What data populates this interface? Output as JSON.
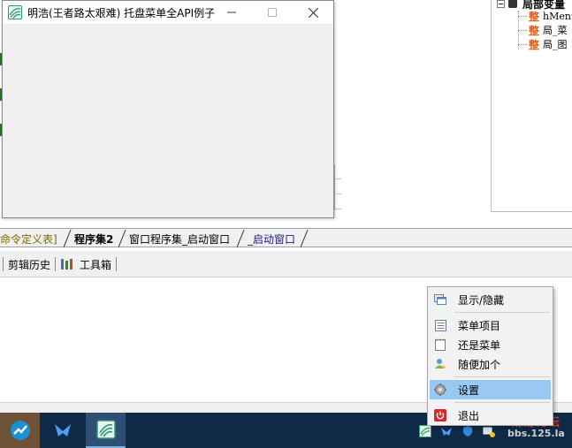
{
  "dialog": {
    "title": "明浩(王者路太艰难) 托盘菜单全API例子",
    "minimize_glyph": "—",
    "maximize_glyph": "☐",
    "close_glyph": "✕"
  },
  "tree": {
    "header": "局部变量",
    "expander": "−",
    "items": [
      {
        "badge": "整",
        "label": "hMenu"
      },
      {
        "badge": "整",
        "label": "局_菜"
      },
      {
        "badge": "整",
        "label": "局_图"
      }
    ]
  },
  "tabs": [
    {
      "label": "命令定义表]"
    },
    {
      "label": "程序集2"
    },
    {
      "label": "窗口程序集_启动窗口"
    },
    {
      "label": "_启动窗口"
    }
  ],
  "toolbar": {
    "clipboard_history": "剪辑历史",
    "toolbox": "工具箱"
  },
  "context_menu": {
    "items": [
      {
        "label": "显示/隐藏",
        "icon": "window-icon"
      },
      {
        "label": "菜单项目",
        "icon": "list-icon"
      },
      {
        "label": "还是菜单",
        "icon": "notepad-icon"
      },
      {
        "label": "随便加个",
        "icon": "user-icon"
      },
      {
        "label": "设置",
        "icon": "gear-icon"
      },
      {
        "label": "退出",
        "icon": "power-icon"
      }
    ],
    "hovered_index": 4
  },
  "watermark": {
    "line1": "精易论坛",
    "line2": "bbs.125.la"
  },
  "colors": {
    "menu_hover": "#99c9f2",
    "taskbar": "#0e2a47",
    "tree_badge": "#e85a10",
    "tab_active_text": "#000000",
    "tab_inactive_text": "#1a1a8a",
    "tab_olive_text": "#7a6a00",
    "exit_icon_bg": "#d62828"
  }
}
